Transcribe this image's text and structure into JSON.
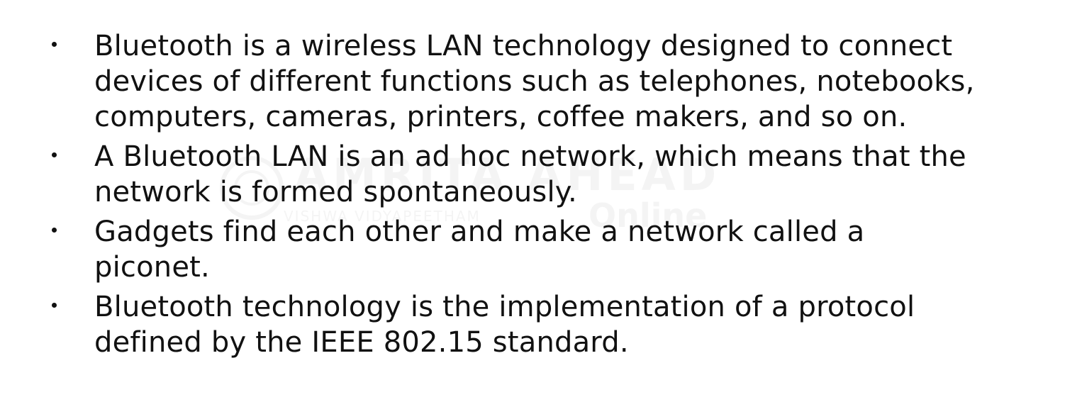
{
  "watermark": {
    "title": "AMRITA AHEAD",
    "subtitle": "VISHWA VIDYAPEETHAM",
    "tag": "Online"
  },
  "bullets": [
    {
      "text": "Bluetooth is a wireless LAN technology designed to connect\ndevices of different functions such as telephones, notebooks,\ncomputers, cameras, printers, coffee makers, and so on."
    },
    {
      "text": "A Bluetooth LAN is an ad hoc network, which means that the\nnetwork is formed spontaneously."
    },
    {
      "text": "Gadgets  find each other and make a network called a\npiconet."
    },
    {
      "text": "Bluetooth technology is the implementation of a protocol\ndefined by the IEEE 802.15 standard."
    }
  ]
}
